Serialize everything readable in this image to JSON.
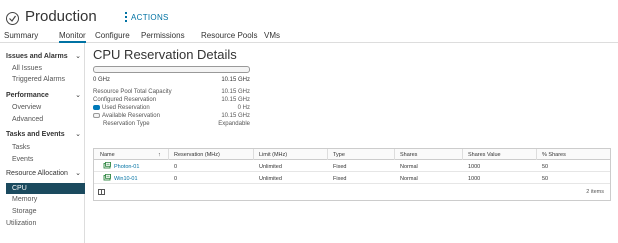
{
  "header": {
    "title": "Production",
    "title_icon": "resource-pool-icon",
    "actions_label": "ACTIONS"
  },
  "tabs": [
    {
      "label": "Summary",
      "active": false
    },
    {
      "label": "Monitor",
      "active": true
    },
    {
      "label": "Configure",
      "active": false
    },
    {
      "label": "Permissions",
      "active": false
    },
    {
      "label": "Resource Pools",
      "active": false
    },
    {
      "label": "VMs",
      "active": false
    }
  ],
  "sidebar": {
    "groups": [
      {
        "label": "Issues and Alarms",
        "items": [
          "All Issues",
          "Triggered Alarms"
        ]
      },
      {
        "label": "Performance",
        "items": [
          "Overview",
          "Advanced"
        ]
      },
      {
        "label": "Tasks and Events",
        "items": [
          "Tasks",
          "Events"
        ]
      },
      {
        "label": "Resource Allocation",
        "items": [
          "CPU",
          "Memory",
          "Storage"
        ]
      }
    ],
    "selected": "CPU",
    "utilization": "Utilization"
  },
  "main": {
    "title": "CPU Reservation Details",
    "bar": {
      "min": "0 GHz",
      "max": "10.15 GHz",
      "used_fraction": 0
    },
    "stats": [
      {
        "label": "Resource Pool Total Capacity",
        "value": "10.15 GHz"
      },
      {
        "label": "Configured Reservation",
        "value": "10.15 GHz"
      },
      {
        "label": "Used Reservation",
        "value": "0 Hz",
        "legend": "used"
      },
      {
        "label": "Available Reservation",
        "value": "10.15 GHz",
        "legend": "available"
      },
      {
        "label": "Reservation Type",
        "value": "Expandable"
      }
    ],
    "colors": {
      "accent": "#0072a3",
      "used": "#0079b8",
      "selected_bg": "#1b4a5e"
    }
  },
  "table": {
    "columns": [
      "Name",
      "Reservation (MHz)",
      "Limit (MHz)",
      "Type",
      "Shares",
      "Shares Value",
      "% Shares"
    ],
    "rows": [
      [
        "Photon-01",
        "0",
        "Unlimited",
        "Fixed",
        "Normal",
        "1000",
        "50"
      ],
      [
        "Win10-01",
        "0",
        "Unlimited",
        "Fixed",
        "Normal",
        "1000",
        "50"
      ]
    ],
    "row_icon": "vm-icon",
    "count": "2 items"
  }
}
